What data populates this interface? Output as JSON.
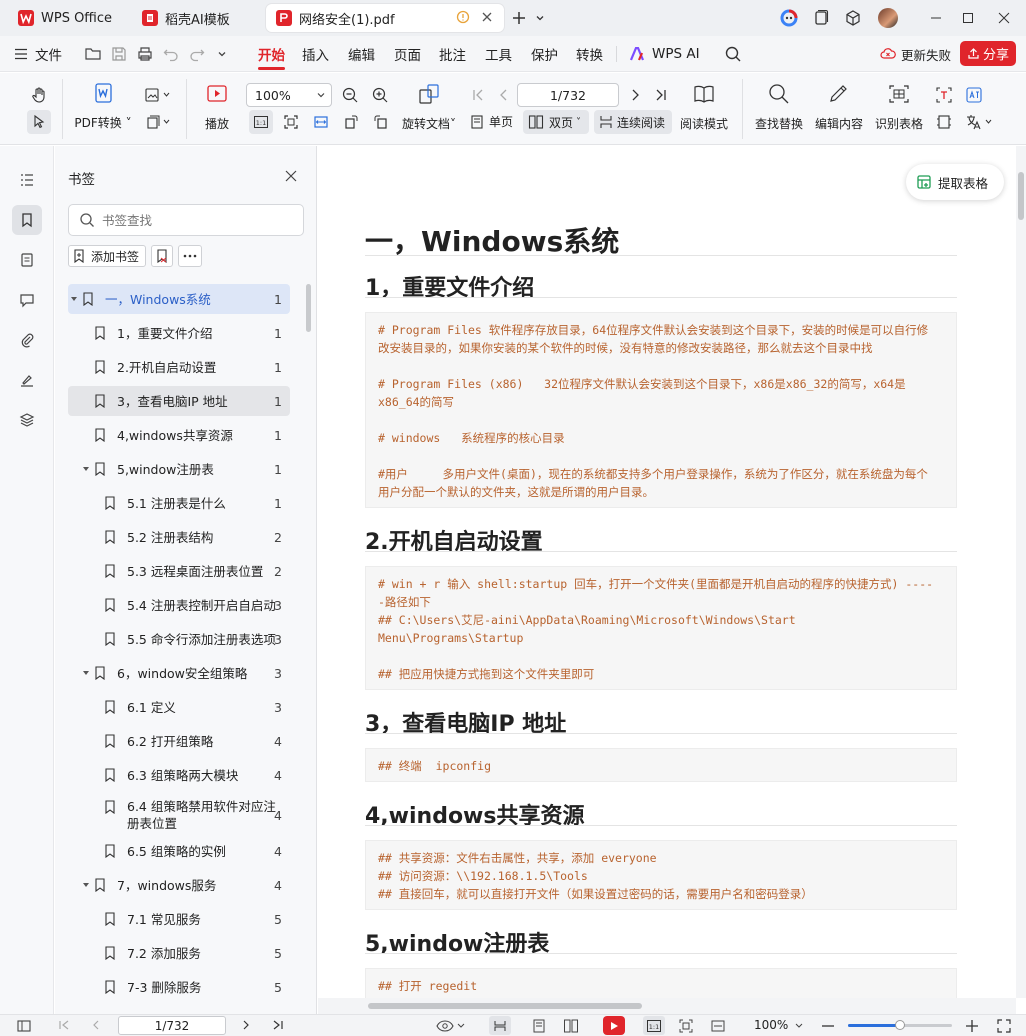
{
  "tabs": [
    {
      "label": "WPS Office",
      "icon": "wps-logo-icon"
    },
    {
      "label": "稻壳AI模板",
      "icon": "docer-icon"
    },
    {
      "label": "网络安全(1).pdf",
      "icon": "pdf-icon"
    }
  ],
  "menu": {
    "file": "文件",
    "items": [
      "开始",
      "插入",
      "编辑",
      "页面",
      "批注",
      "工具",
      "保护",
      "转换"
    ],
    "wps_ai": "WPS AI",
    "sync_failed": "更新失败",
    "share": "分享"
  },
  "ribbon": {
    "pdf_convert": "PDF转换",
    "play": "播放",
    "zoom": "100%",
    "rotate": "旋转文档",
    "page_input": "1/732",
    "single": "单页",
    "double": "双页",
    "continuous": "连续阅读",
    "reading_mode": "阅读模式",
    "find_replace": "查找替换",
    "edit_content": "编辑内容",
    "recognize_table": "识别表格"
  },
  "panel": {
    "title": "书签",
    "search_placeholder": "书签查找",
    "add_bookmark": "添加书签",
    "items": [
      {
        "label": "一，Windows系统",
        "page": "1"
      },
      {
        "label": "1，重要文件介绍",
        "page": "1"
      },
      {
        "label": "2.开机自启动设置",
        "page": "1"
      },
      {
        "label": "3，查看电脑IP 地址",
        "page": "1"
      },
      {
        "label": "4,windows共享资源",
        "page": "1"
      },
      {
        "label": "5,window注册表",
        "page": "1"
      },
      {
        "label": "5.1 注册表是什么",
        "page": "1"
      },
      {
        "label": "5.2 注册表结构",
        "page": "2"
      },
      {
        "label": "5.3 远程桌面注册表位置",
        "page": "2"
      },
      {
        "label": "5.4 注册表控制开启自启动",
        "page": "3"
      },
      {
        "label": "5.5 命令行添加注册表选项",
        "page": "3"
      },
      {
        "label": "6，window安全组策略",
        "page": "3"
      },
      {
        "label": "6.1 定义",
        "page": "3"
      },
      {
        "label": "6.2 打开组策略",
        "page": "4"
      },
      {
        "label": "6.3 组策略两大模块",
        "page": "4"
      },
      {
        "label": "6.4 组策略禁用软件对应注",
        "label2": "册表位置",
        "page": "4"
      },
      {
        "label": "6.5 组策略的实例",
        "page": "4"
      },
      {
        "label": "7，windows服务",
        "page": "4"
      },
      {
        "label": "7.1 常见服务",
        "page": "5"
      },
      {
        "label": "7.2 添加服务",
        "page": "5"
      },
      {
        "label": "7-3 删除服务",
        "page": "5"
      }
    ]
  },
  "doc": {
    "extract_table": "提取表格",
    "title": "一，Windows系统",
    "s1": "1，重要文件介绍",
    "s1_code": [
      "# Program Files 软件程序存放目录，64位程序文件默认会安装到这个目录下，安装的时候是可以自行修",
      "改安装目录的，如果你安装的某个软件的时候，没有特意的修改安装路径，那么就去这个目录中找",
      "",
      "# Program Files (x86)   32位程序文件默认会安装到这个目录下，x86是x86_32的简写，x64是",
      "x86_64的简写",
      "",
      "# windows   系统程序的核心目录",
      "",
      "#用户     多用户文件(桌面)，现在的系统都支持多个用户登录操作，系统为了作区分，就在系统盘为每个",
      "用户分配一个默认的文件夹，这就是所谓的用户目录。"
    ],
    "s2": "2.开机自启动设置",
    "s2_code": [
      "# win + r 输入 shell:startup 回车，打开一个文件夹(里面都是开机自启动的程序的快捷方式) ----",
      "-路径如下",
      "## C:\\Users\\艾尼-aini\\AppData\\Roaming\\Microsoft\\Windows\\Start",
      "Menu\\Programs\\Startup",
      "",
      "## 把应用快捷方式拖到这个文件夹里即可"
    ],
    "s3": "3，查看电脑IP 地址",
    "s3_code": [
      "## 终端  ipconfig"
    ],
    "s4": "4,windows共享资源",
    "s4_code": [
      "## 共享资源：文件右击属性，共享，添加 everyone",
      "## 访问资源：\\\\192.168.1.5\\Tools",
      "## 直接回车，就可以直接打开文件（如果设置过密码的话，需要用户名和密码登录）"
    ],
    "s5": "5,window注册表",
    "s5_code": [
      "## 打开 regedit"
    ]
  },
  "status": {
    "page": "1/732",
    "zoom": "100%"
  },
  "colors": {
    "accent": "#e0252b",
    "code_text": "#b8632f",
    "selected": "#dde6f7"
  }
}
